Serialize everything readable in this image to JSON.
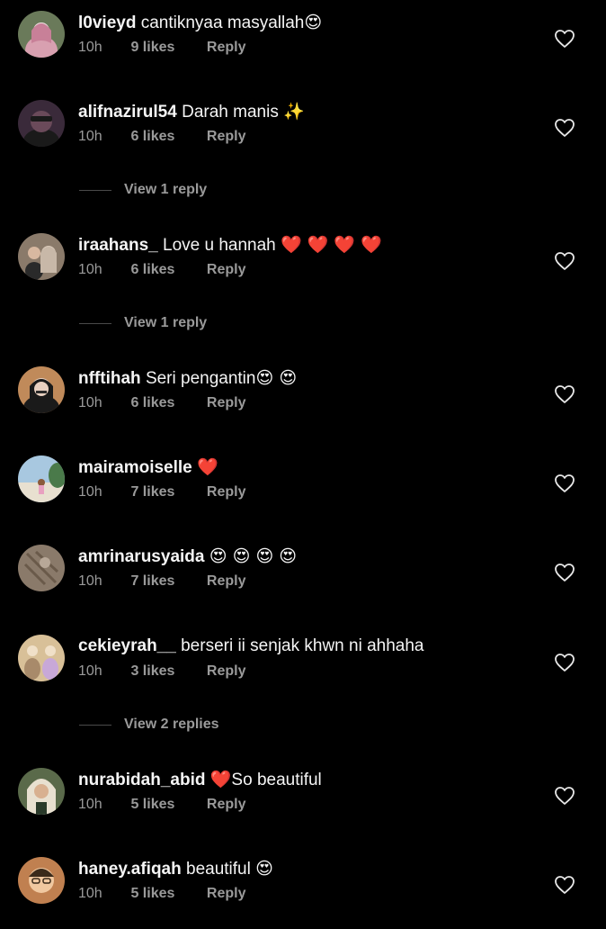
{
  "comments": [
    {
      "username": "l0vieyd",
      "text": "cantiknyaa masyallah",
      "emoji": "😍",
      "time": "10h",
      "likes": "9 likes",
      "reply": "Reply",
      "avatar_colors": [
        "#6a7a5a",
        "#d8a0b0",
        "#f1e3e3"
      ]
    },
    {
      "username": "alifnazirul54",
      "text": "Darah manis",
      "emoji": "✨",
      "time": "10h",
      "likes": "6 likes",
      "reply": "Reply",
      "avatar_colors": [
        "#3a2a3a",
        "#1a1a1a",
        "#6a4a5a"
      ]
    },
    {
      "username": "iraahans_",
      "text": "Love u hannah",
      "emoji": "❤️ ❤️ ❤️ ❤️",
      "time": "10h",
      "likes": "6 likes",
      "reply": "Reply",
      "avatar_colors": [
        "#8a7a6a",
        "#2a2a2a",
        "#d8c8b8"
      ]
    },
    {
      "username": "nfftihah",
      "text": "Seri pengantin",
      "emoji": "😍 😍",
      "time": "10h",
      "likes": "6 likes",
      "reply": "Reply",
      "avatar_colors": [
        "#c08a5a",
        "#1a1a1a",
        "#e8d0c0"
      ]
    },
    {
      "username": "mairamoiselle",
      "text": "",
      "emoji": "❤️",
      "time": "10h",
      "likes": "7 likes",
      "reply": "Reply",
      "avatar_colors": [
        "#a8c8e0",
        "#4a7a4a",
        "#e8e0d0"
      ]
    },
    {
      "username": "amrinarusyaida",
      "text": "",
      "emoji": "😍 😍 😍 😍",
      "time": "10h",
      "likes": "7 likes",
      "reply": "Reply",
      "avatar_colors": [
        "#8a7a6a",
        "#6a5a4a",
        "#b8a898"
      ]
    },
    {
      "username": "cekieyrah__",
      "text": "berseri ii senjak khwn ni ahhaha",
      "emoji": "",
      "time": "10h",
      "likes": "3 likes",
      "reply": "Reply",
      "avatar_colors": [
        "#d8c098",
        "#a88a6a",
        "#f0e0c8"
      ]
    },
    {
      "username": "nurabidah_abid",
      "text": "So beautiful",
      "emoji": "❤️",
      "emoji_before_text": true,
      "time": "10h",
      "likes": "5 likes",
      "reply": "Reply",
      "avatar_colors": [
        "#5a6a4a",
        "#e8e0d0",
        "#2a3a2a"
      ]
    },
    {
      "username": "haney.afiqah",
      "text": "beautiful",
      "emoji": "😍",
      "time": "10h",
      "likes": "5 likes",
      "reply": "Reply",
      "avatar_colors": [
        "#c08050",
        "#f0c8a0",
        "#3a2a1a"
      ]
    }
  ],
  "view_replies": [
    "View 1 reply",
    "View 1 reply",
    "View 2 replies"
  ],
  "colors": {
    "background": "#000000",
    "text": "#f5f5f5",
    "muted": "#9a9a9a",
    "divider": "#4a4a4a"
  },
  "icons": {
    "like": "heart-outline-icon"
  }
}
